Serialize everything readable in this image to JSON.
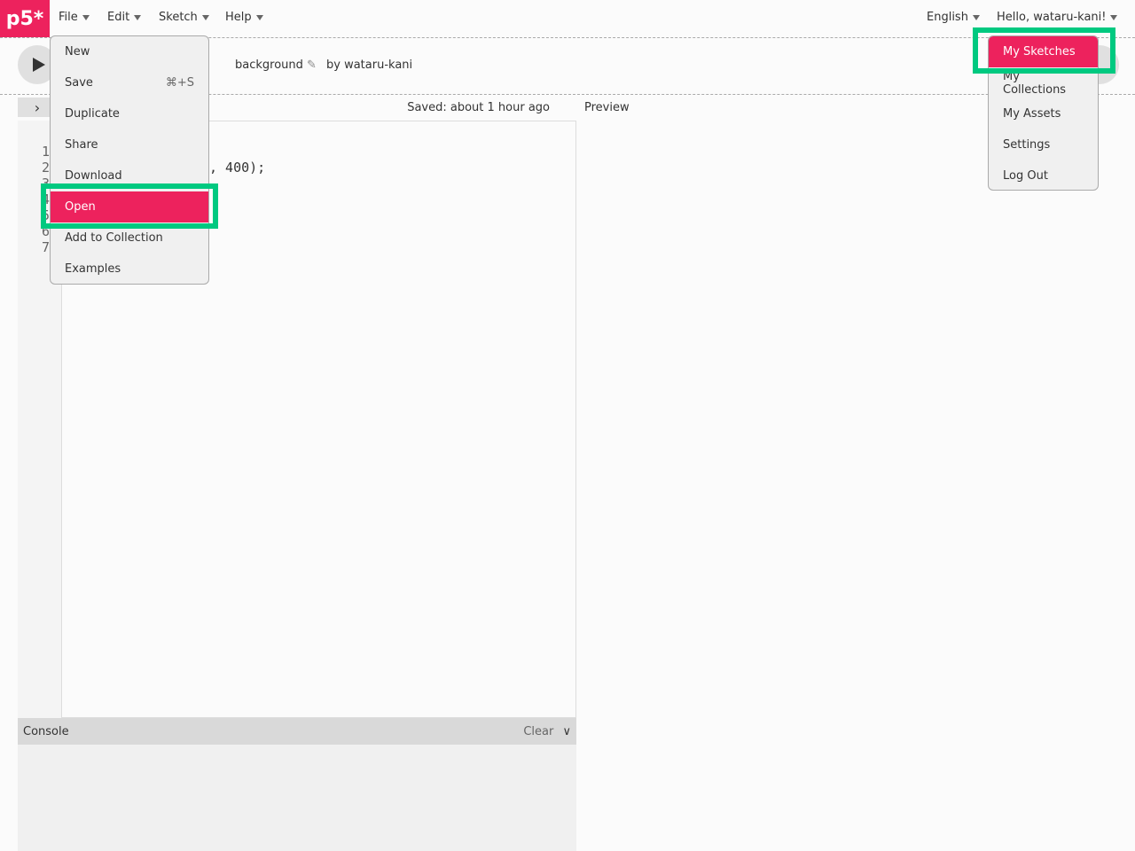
{
  "logo": "p5*",
  "nav": {
    "items": [
      {
        "label": "File"
      },
      {
        "label": "Edit"
      },
      {
        "label": "Sketch"
      },
      {
        "label": "Help"
      }
    ],
    "language": "English",
    "user_greeting": "Hello, wataru-kani!"
  },
  "toolbar": {
    "sketch_name": "background",
    "author": "by wataru-kani"
  },
  "editor": {
    "saved_status": "Saved: about 1 hour ago",
    "preview_label": "Preview",
    "line_numbers": [
      "1",
      "2",
      "3",
      "4",
      "5",
      "6",
      "7"
    ],
    "visible_code": ", 400);"
  },
  "console": {
    "title": "Console",
    "clear_label": "Clear"
  },
  "file_menu": {
    "items": [
      {
        "label": "New"
      },
      {
        "label": "Save",
        "shortcut": "⌘+S"
      },
      {
        "label": "Duplicate"
      },
      {
        "label": "Share"
      },
      {
        "label": "Download"
      },
      {
        "label": "Open",
        "highlighted": true
      },
      {
        "label": "Add to Collection"
      },
      {
        "label": "Examples"
      }
    ]
  },
  "user_menu": {
    "items": [
      {
        "label": "My Sketches",
        "highlighted": true
      },
      {
        "label": "My Collections"
      },
      {
        "label": "My Assets"
      },
      {
        "label": "Settings"
      },
      {
        "label": "Log Out"
      }
    ]
  },
  "colors": {
    "accent": "#ed225d",
    "highlight_box": "#00c980"
  }
}
